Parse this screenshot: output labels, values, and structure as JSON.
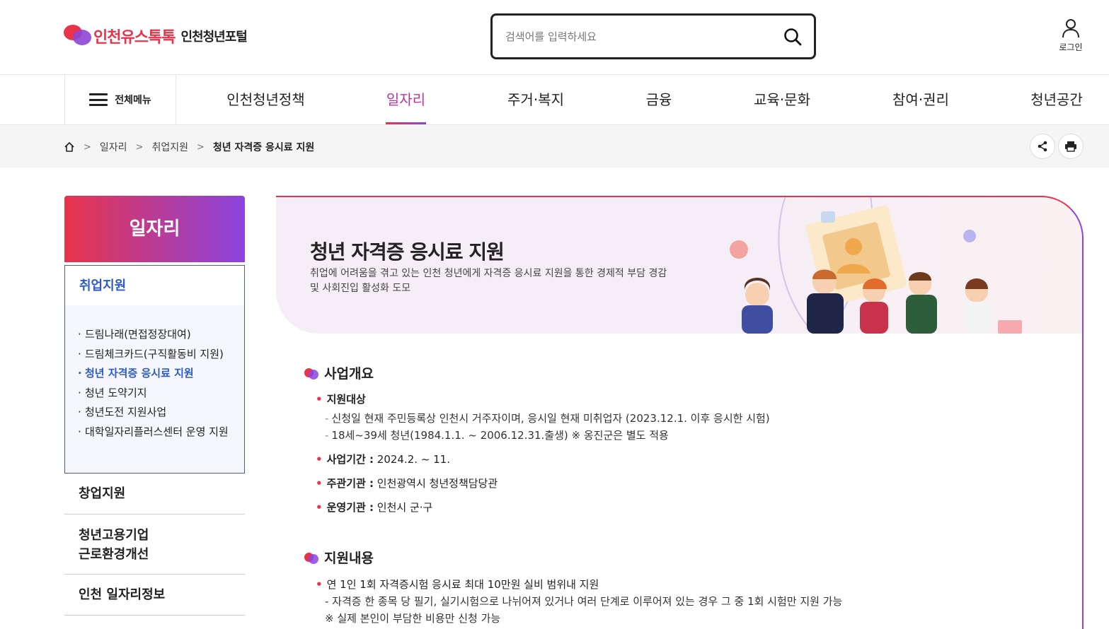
{
  "header": {
    "logo_main": "인천유스톡톡",
    "logo_sub": "인천청년포털",
    "search_placeholder": "검색어를 입력하세요",
    "login_label": "로그인"
  },
  "nav": {
    "allmenu_label": "전체메뉴",
    "items": [
      "인천청년정책",
      "일자리",
      "주거·복지",
      "금융",
      "교육·문화",
      "참여·권리",
      "청년공간"
    ],
    "active_index": 1
  },
  "breadcrumb": {
    "items": [
      "일자리",
      "취업지원",
      "청년 자격증 응시료 지원"
    ]
  },
  "sidebar": {
    "title": "일자리",
    "group_title": "취업지원",
    "group_items": [
      "드림나래(면접정장대여)",
      "드림체크카드(구직활동비 지원)",
      "청년 자격증 응시료 지원",
      "청년 도약기지",
      "청년도전 지원사업",
      "대학일자리플러스센터 운영 지원"
    ],
    "active_item_index": 2,
    "other_items": [
      "창업지원",
      "청년고용기업 근로환경개선",
      "인천 일자리정보"
    ]
  },
  "banner": {
    "title": "청년 자격증 응시료 지원",
    "description": "취업에 어려움을 겪고 있는 인천 청년에게 자격증 응시료 지원을 통한 경제적 부담 경감 및 사회진입 활성화 도모"
  },
  "overview": {
    "heading": "사업개요",
    "target_label": "지원대상",
    "target_lines": [
      "신청일 현재 주민등록상 인천시 거주자이며, 응시일 현재 미취업자 (2023.12.1. 이후 응시한 시험)",
      "18세~39세 청년(1984.1.1. ~ 2006.12.31.출생) ※ 옹진군은 별도 적용"
    ],
    "period_label": "사업기간 :",
    "period_value": " 2024.2. ~ 11.",
    "host_label": "주관기관 :",
    "host_value": " 인천광역시 청년정책담당관",
    "operator_label": "운영기관 :",
    "operator_value": " 인천시 군·구"
  },
  "support": {
    "heading": "지원내용",
    "lines": [
      "연 1인 1회 자격증시험 응시료 최대 10만원 실비 범위내 지원",
      "- 자격증 한 종목 당 필기, 실기시험으로 나뉘어져 있거나 여러 단계로 이루어져 있는 경우 그 중 1회 시험만 지원 가능",
      "※ 실제 본인이 부담한 비용만 신청 가능"
    ]
  },
  "colors": {
    "brand_red": "#e8334a",
    "brand_purple": "#8b44e0",
    "active_blue": "#2c5ac8"
  }
}
